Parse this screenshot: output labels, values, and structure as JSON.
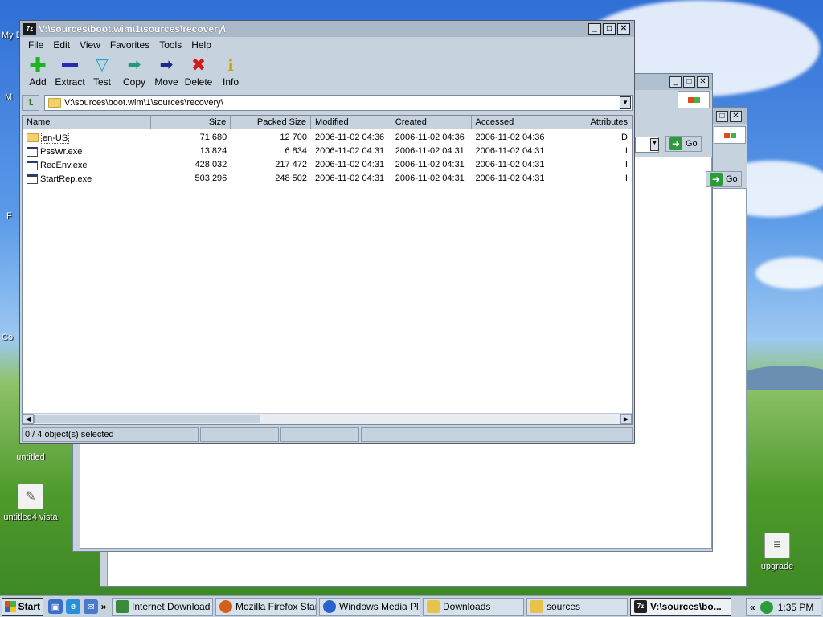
{
  "desktop": {
    "icons": [
      {
        "label": "untitled"
      },
      {
        "label": "untitled4 vista"
      },
      {
        "label": "upgrade"
      }
    ],
    "clipped_labels": [
      "My D",
      "M",
      "F",
      "Co"
    ]
  },
  "window": {
    "title": "V:\\sources\\boot.wim\\1\\sources\\recovery\\",
    "app_icon_text": "7z",
    "menu": [
      "File",
      "Edit",
      "View",
      "Favorites",
      "Tools",
      "Help"
    ],
    "toolbar": [
      {
        "label": "Add",
        "icon": "plus-icon",
        "color": "#1fb31f"
      },
      {
        "label": "Extract",
        "icon": "minus-icon",
        "color": "#2a2ab8"
      },
      {
        "label": "Test",
        "icon": "check-icon",
        "color": "#1fa8c9"
      },
      {
        "label": "Copy",
        "icon": "double-arrow-icon",
        "color": "#1f9a7a"
      },
      {
        "label": "Move",
        "icon": "arrow-right-icon",
        "color": "#1a2a8a"
      },
      {
        "label": "Delete",
        "icon": "x-icon",
        "color": "#d11a1a"
      },
      {
        "label": "Info",
        "icon": "info-icon",
        "color": "#c9a600"
      }
    ],
    "address": "V:\\sources\\boot.wim\\1\\sources\\recovery\\",
    "columns": [
      "Name",
      "Size",
      "Packed Size",
      "Modified",
      "Created",
      "Accessed",
      "Attributes"
    ],
    "files": [
      {
        "name": "en-US",
        "type": "folder",
        "size": "71 680",
        "packed": "12 700",
        "modified": "2006-11-02 04:36",
        "created": "2006-11-02 04:36",
        "accessed": "2006-11-02 04:36",
        "attr": "D"
      },
      {
        "name": "PssWr.exe",
        "type": "exe",
        "size": "13 824",
        "packed": "6 834",
        "modified": "2006-11-02 04:31",
        "created": "2006-11-02 04:31",
        "accessed": "2006-11-02 04:31",
        "attr": "I"
      },
      {
        "name": "RecEnv.exe",
        "type": "exe",
        "size": "428 032",
        "packed": "217 472",
        "modified": "2006-11-02 04:31",
        "created": "2006-11-02 04:31",
        "accessed": "2006-11-02 04:31",
        "attr": "I"
      },
      {
        "name": "StartRep.exe",
        "type": "exe",
        "size": "503 296",
        "packed": "248 502",
        "modified": "2006-11-02 04:31",
        "created": "2006-11-02 04:31",
        "accessed": "2006-11-02 04:31",
        "attr": "I"
      }
    ],
    "status": "0 / 4 object(s) selected"
  },
  "background_windows": {
    "go_label": "Go"
  },
  "taskbar": {
    "start_label": "Start",
    "chevron": "»",
    "tray_chevron": "«",
    "tasks": [
      {
        "label": "Internet Download ...",
        "color": "#3a8a3a",
        "active": false
      },
      {
        "label": "Mozilla Firefox Star...",
        "color": "#d2601a",
        "active": false
      },
      {
        "label": "Windows Media Pl...",
        "color": "#2a62c9",
        "active": false
      },
      {
        "label": "Downloads",
        "color": "#e8c24a",
        "active": false
      },
      {
        "label": "sources",
        "color": "#e8c24a",
        "active": false
      },
      {
        "label": "V:\\sources\\bo...",
        "color": "#222222",
        "active": true
      }
    ],
    "clock": "1:35 PM"
  }
}
